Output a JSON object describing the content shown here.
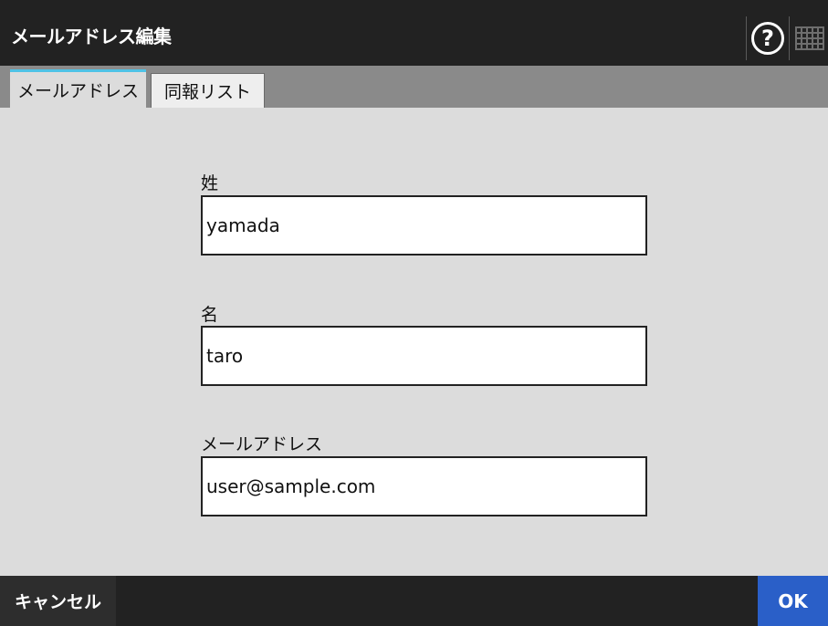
{
  "window": {
    "title": "メールアドレス編集",
    "help_icon": "help-circle-icon",
    "help_glyph": "?",
    "keyboard_icon": "keyboard-icon"
  },
  "tabs": [
    {
      "label": "メールアドレス",
      "active": true
    },
    {
      "label": "同報リスト",
      "active": false
    }
  ],
  "form": {
    "last_name": {
      "label": "姓",
      "value": "yamada"
    },
    "first_name": {
      "label": "名",
      "value": "taro"
    },
    "email": {
      "label": "メールアドレス",
      "value": "user@sample.com"
    }
  },
  "footer": {
    "cancel_label": "キャンセル",
    "ok_label": "OK"
  },
  "colors": {
    "titlebar": "#222222",
    "tab_accent": "#4fc3e6",
    "ok_button": "#2a5fc8"
  }
}
